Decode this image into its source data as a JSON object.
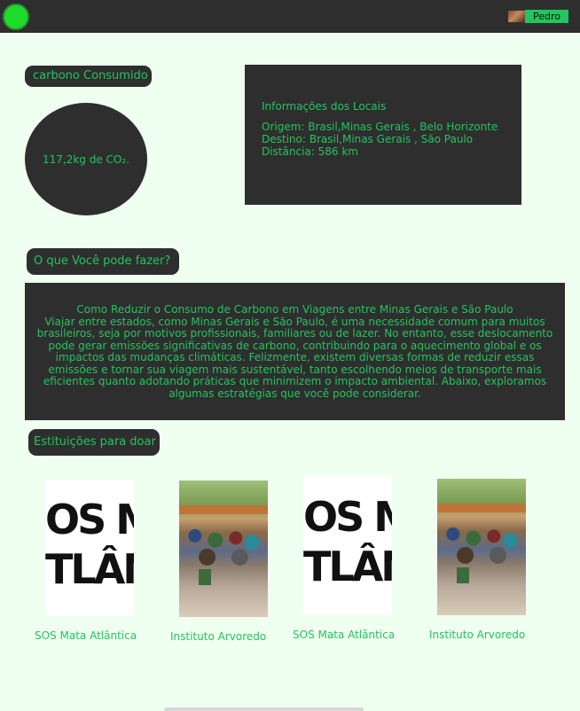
{
  "header": {
    "user_name": "Pedro",
    "logo_icon": "green-circle-logo",
    "avatar_icon": "user-avatar-photo"
  },
  "carbon": {
    "section_label": "carbono Consumido",
    "value": "117,2kg de CO₂."
  },
  "locations": {
    "title": "Informações dos Locais",
    "origin": "Origem: Brasil,Minas Gerais , Belo Horizonte",
    "destination": "Destino: Brasil,Minas Gerais , São Paulo",
    "distance": "Distância: 586 km"
  },
  "tips": {
    "section_label": "O que Você pode fazer?",
    "heading": "Como Reduzir o Consumo de Carbono em Viagens entre Minas Gerais e São Paulo",
    "body": "Viajar entre estados, como Minas Gerais e São Paulo, é uma necessidade comum para muitos brasileiros, seja por motivos profissionais, familiares ou de lazer. No entanto, esse deslocamento pode gerar emissões significativas de carbono, contribuindo para o aquecimento global e os impactos das mudanças climáticas. Felizmente, existem diversas formas de reduzir essas emissões e tornar sua viagem mais sustentável, tanto escolhendo meios de transporte mais eficientes quanto adotando práticas que minimizem o impacto ambiental. Abaixo, exploramos algumas estratégias que você pode considerar."
  },
  "institutions": {
    "section_label": "Estituições para doar",
    "logo_text_line1": "OS M",
    "logo_text_line2": "TLÂN",
    "items": [
      {
        "name": "SOS Mata Atlântica",
        "image": "sos-mata-atlantica-logo"
      },
      {
        "name": "Instituto Arvoredo",
        "image": "instituto-arvoredo-photo"
      },
      {
        "name": "SOS Mata Atlântica",
        "image": "sos-mata-atlantica-logo"
      },
      {
        "name": "Instituto Arvoredo",
        "image": "instituto-arvoredo-photo"
      }
    ]
  },
  "colors": {
    "background": "#effff0",
    "panel": "#2e2e2e",
    "accent": "#22c55e"
  }
}
